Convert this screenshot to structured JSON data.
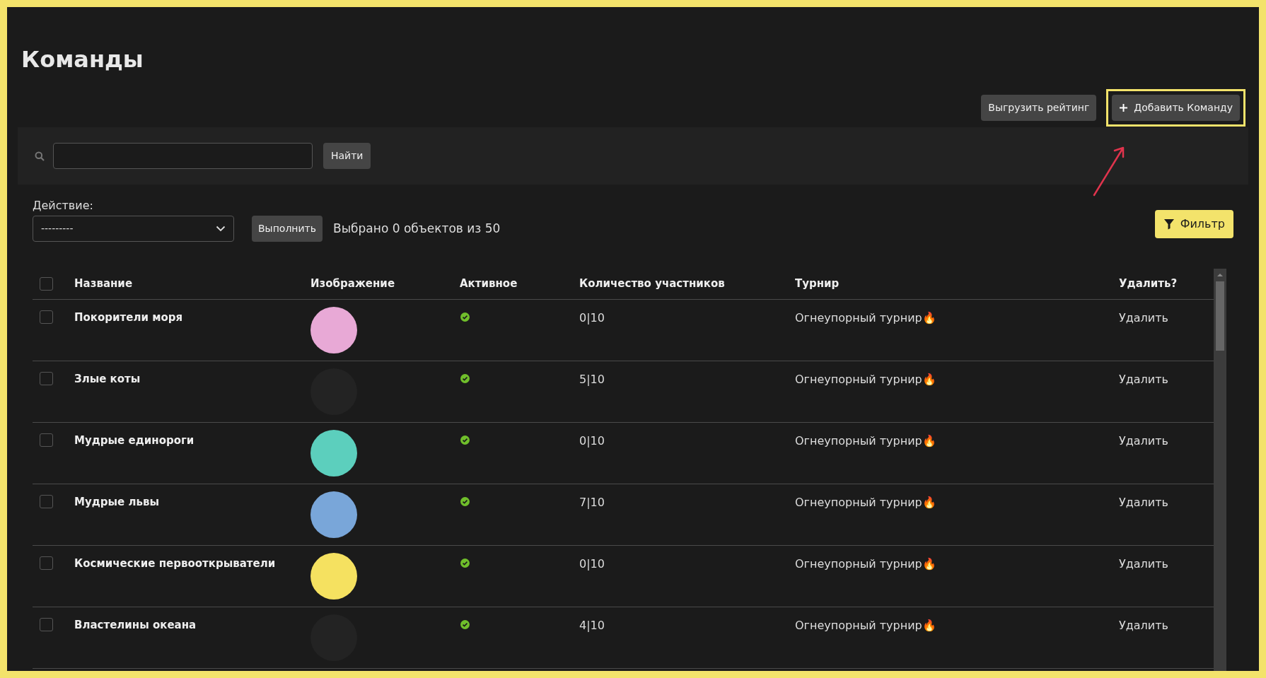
{
  "page_title": "Команды",
  "top_buttons": [
    {
      "label": "Выгрузить рейтинг",
      "kind": "plain",
      "highlighted": false
    },
    {
      "label": "Добавить Команду",
      "kind": "add",
      "highlighted": true
    }
  ],
  "search": {
    "button": "Найти"
  },
  "actions": {
    "label": "Действие:",
    "select_value": "---------",
    "run_button": "Выполнить",
    "selection_count": "Выбрано 0 объектов из 50"
  },
  "filter_button": "Фильтр",
  "table": {
    "select_all_checked": false,
    "columns": [
      "Название",
      "Изображение",
      "Активное",
      "Количество участников",
      "Турнир",
      "Удалить?"
    ],
    "rows": [
      {
        "checked": false,
        "name": "Покорители моря",
        "color": "#e8a9d6",
        "active": true,
        "members": "0|10",
        "tournament": "Огнеупорный турнир🔥",
        "delete": "Удалить"
      },
      {
        "checked": false,
        "name": "Злые коты",
        "active": true,
        "members": "5|10",
        "tournament": "Огнеупорный турнир🔥",
        "delete": "Удалить"
      },
      {
        "checked": false,
        "name": "Мудрые единороги",
        "color": "#5ccfbd",
        "active": true,
        "members": "0|10",
        "tournament": "Огнеупорный турнир🔥",
        "delete": "Удалить"
      },
      {
        "checked": false,
        "name": "Мудрые львы",
        "color": "#79a6d9",
        "active": true,
        "members": "7|10",
        "tournament": "Огнеупорный турнир🔥",
        "delete": "Удалить"
      },
      {
        "checked": false,
        "name": "Космические первооткрыватели",
        "color": "#f5e160",
        "active": true,
        "members": "0|10",
        "tournament": "Огнеупорный турнир🔥",
        "delete": "Удалить"
      },
      {
        "checked": false,
        "name": "Властелины океана",
        "active": true,
        "members": "4|10",
        "tournament": "Огнеупорный турнир🔥",
        "delete": "Удалить"
      }
    ]
  }
}
